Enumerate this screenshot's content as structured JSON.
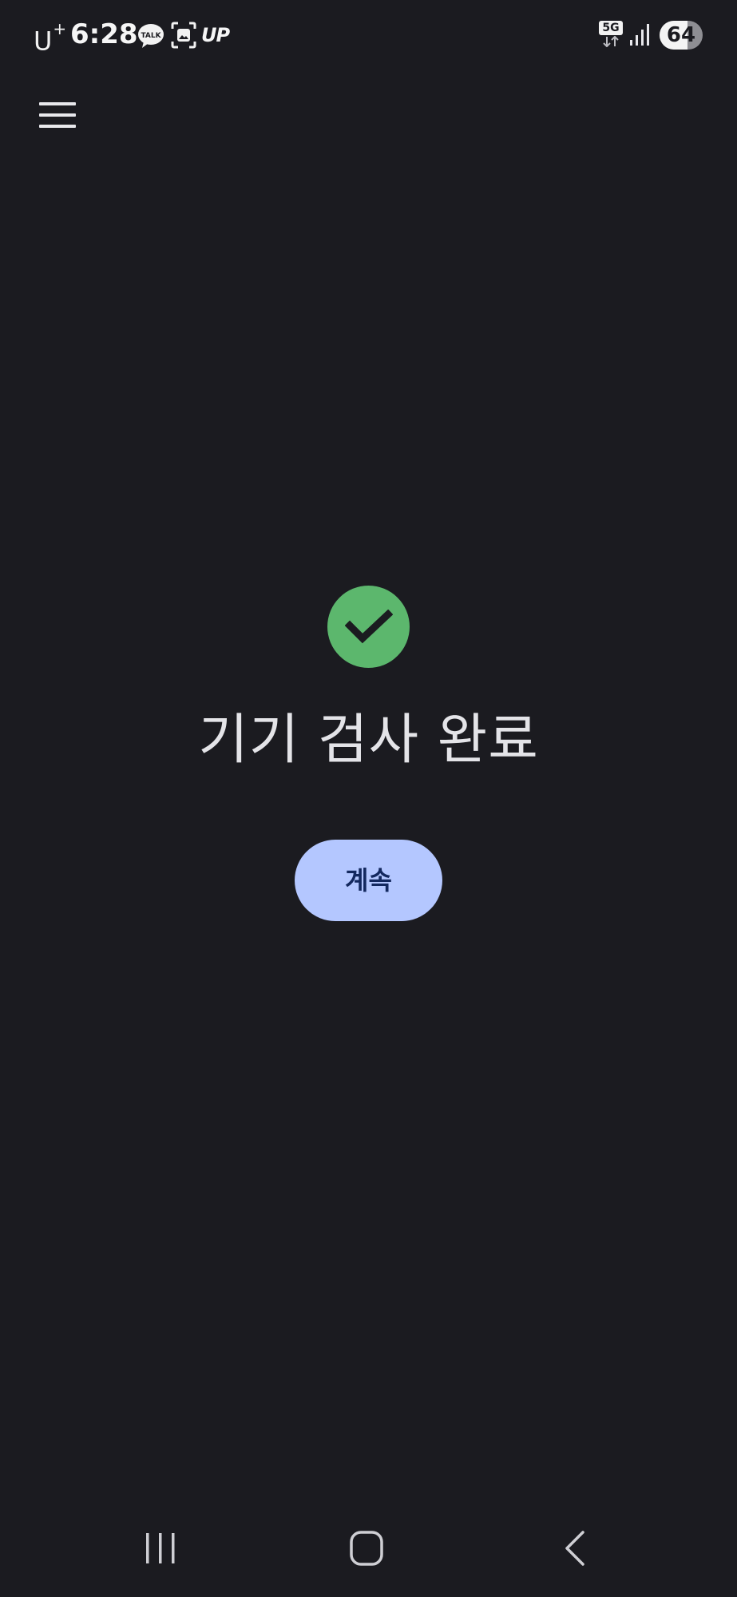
{
  "status_bar": {
    "carrier": "U",
    "carrier_plus": "+",
    "time": "6:28",
    "notification_icons": [
      "kakaotalk-icon",
      "gallery-icon",
      "uplus-app-icon"
    ],
    "talk_label": "TALK",
    "up_label": "UP",
    "network": "5G",
    "signal_icon": "signal-bars-icon",
    "battery_level": "64",
    "battery_fraction": 0.64
  },
  "app_bar": {
    "menu_icon": "hamburger-menu-icon"
  },
  "main": {
    "status_icon": "check-circle-icon",
    "title": "기기 검사 완료",
    "continue_label": "계속"
  },
  "nav_bar": {
    "recent_icon": "recent-apps-icon",
    "home_icon": "home-icon",
    "back_icon": "back-icon"
  },
  "colors": {
    "background": "#1b1b20",
    "check_green": "#5cb76d",
    "button_bg": "#b4c7ff",
    "button_text": "#13285e",
    "title_text": "#e4e4e8"
  }
}
